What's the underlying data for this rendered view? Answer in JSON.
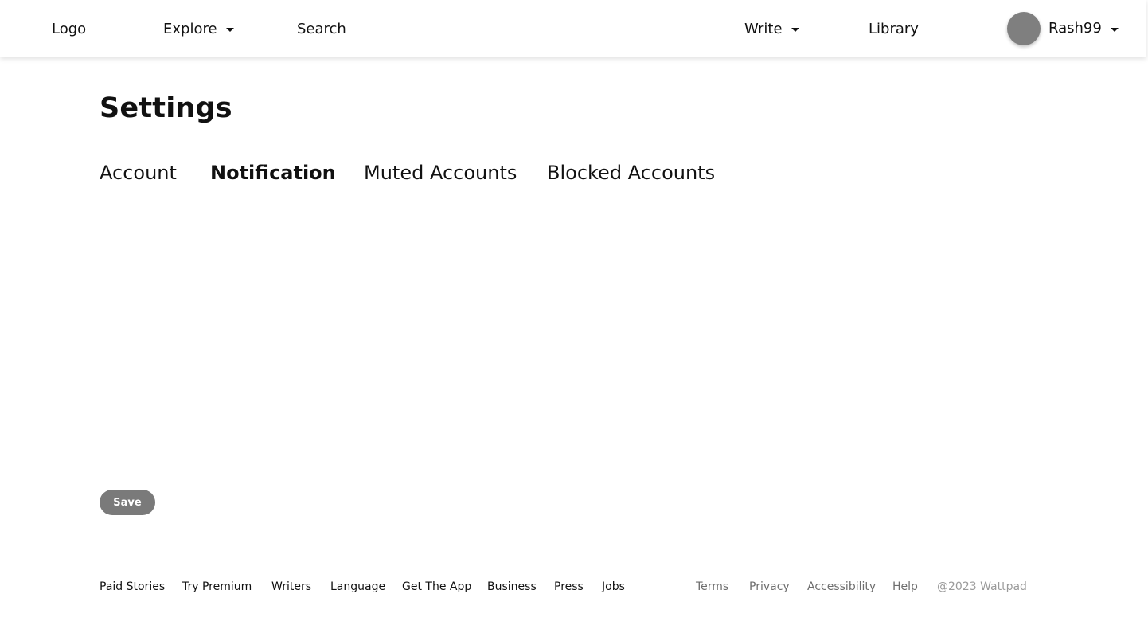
{
  "header": {
    "logo": "Logo",
    "explore": "Explore",
    "search": "Search",
    "write": "Write",
    "library": "Library",
    "username": "Rash99"
  },
  "settings": {
    "title": "Settings",
    "tabs": [
      {
        "label": "Account",
        "active": false
      },
      {
        "label": "Notification",
        "active": true
      },
      {
        "label": "Muted Accounts",
        "active": false
      },
      {
        "label": "Blocked Accounts",
        "active": false
      }
    ],
    "save_label": "Save"
  },
  "footer": {
    "primary_links": [
      "Paid Stories",
      "Try Premium",
      "Writers",
      "Language",
      "Get The App",
      "Business",
      "Press",
      "Jobs"
    ],
    "secondary_links": [
      "Terms",
      "Privacy",
      "Accessibility",
      "Help"
    ],
    "copyright": "@2023 Wattpad"
  },
  "colors": {
    "avatar": "#7f7f7f",
    "save_button": "#7a7a7a",
    "muted_text": "#6e6e6e",
    "faint_text": "#9a9a9a"
  },
  "icons": {
    "dropdown": "caret-down-icon",
    "avatar": "user-avatar"
  }
}
